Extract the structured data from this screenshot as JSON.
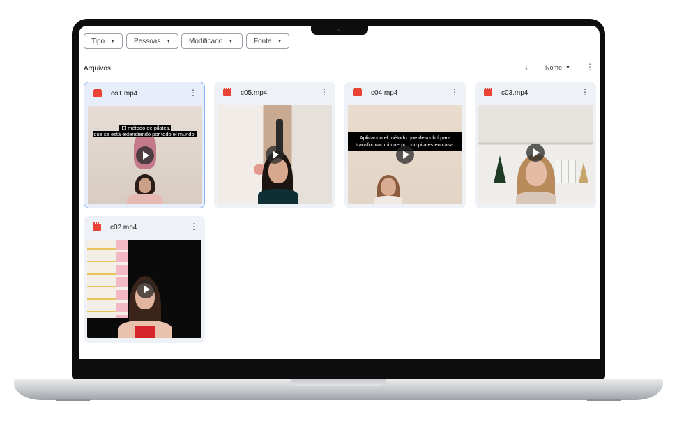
{
  "filters": [
    {
      "label": "Tipo"
    },
    {
      "label": "Pessoas"
    },
    {
      "label": "Modificado"
    },
    {
      "label": "Fonte"
    }
  ],
  "section": {
    "title": "Arquivos",
    "sort_label": "Nome",
    "sort_direction_icon": "arrow-down-icon",
    "more_icon": "more-vert-icon"
  },
  "files": [
    {
      "name": "co1.mp4",
      "caption": "El método de pilates,\nque se está extendiendo por todo el mundo",
      "selected": true
    },
    {
      "name": "c05.mp4",
      "caption": ""
    },
    {
      "name": "c04.mp4",
      "caption": "Aplicando el método que descubrí para transformar mi cuerpo con pilates en casa."
    },
    {
      "name": "c03.mp4",
      "caption": ""
    },
    {
      "name": "c02.mp4",
      "caption": ""
    }
  ],
  "colors": {
    "accent": "#8ab4f8",
    "card_bg": "#eef1f6",
    "video_icon": "#ea4335"
  }
}
